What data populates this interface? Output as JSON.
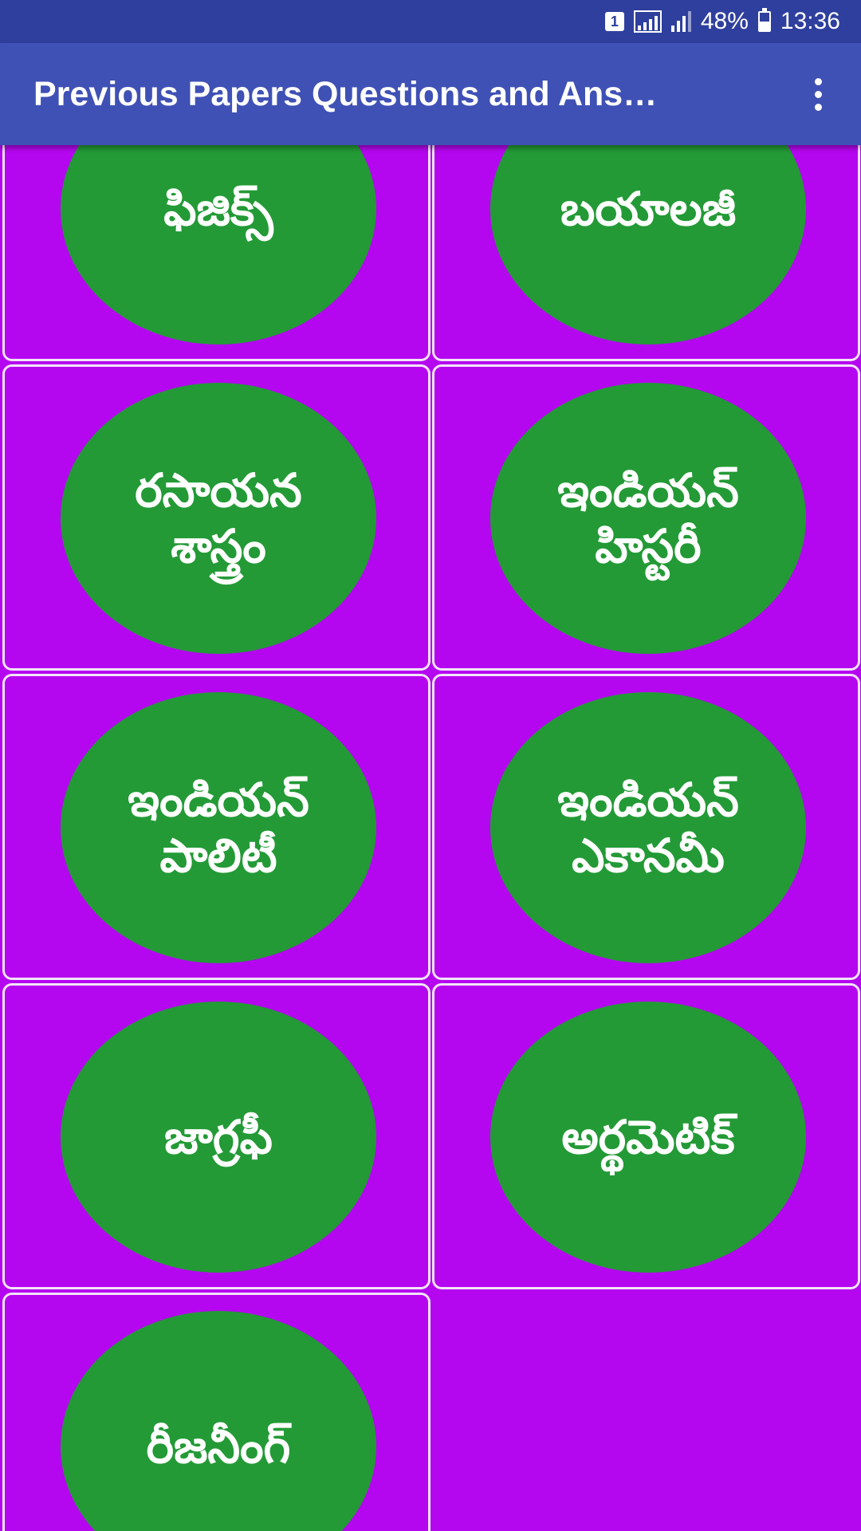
{
  "status_bar": {
    "sim": "1",
    "battery_percent": "48%",
    "battery_level": 0.48,
    "time": "13:36"
  },
  "app_bar": {
    "title": "Previous Papers Questions and Ans…",
    "overflow_icon": "more-vert-icon"
  },
  "colors": {
    "status_bar": "#2f3f9e",
    "app_bar": "#3f51b5",
    "tile_background": "#b506f0",
    "circle": "#239a36"
  },
  "tiles": [
    {
      "label": "ఫిజిక్స్"
    },
    {
      "label": "బయాలజీ"
    },
    {
      "label": "రసాయన శాస్త్రం"
    },
    {
      "label": "ఇండియన్ హిస్టరీ"
    },
    {
      "label": "ఇండియన్ పాలిటీ"
    },
    {
      "label": "ఇండియన్ ఎకానమీ"
    },
    {
      "label": "జాగ్రఫీ"
    },
    {
      "label": "అర్థమెటిక్"
    },
    {
      "label": "రీజనీంగ్"
    }
  ]
}
